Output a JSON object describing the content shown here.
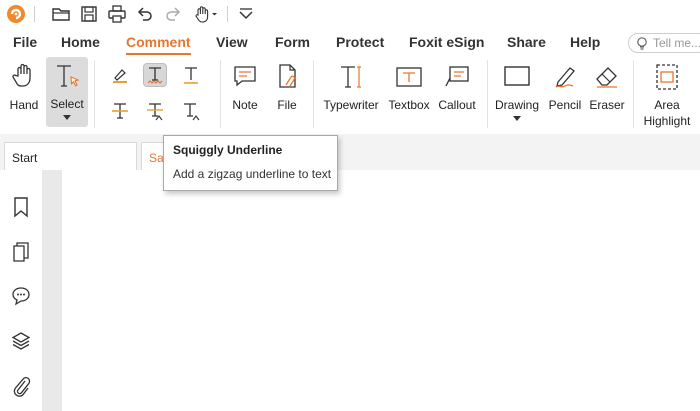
{
  "quick_access": {
    "icons": [
      "foxit-logo-icon",
      "open-folder-icon",
      "save-icon",
      "print-icon",
      "undo-icon",
      "redo-icon",
      "hand-dropdown-icon",
      "customize-chevron-icon"
    ]
  },
  "menu": {
    "tabs": [
      "File",
      "Home",
      "Comment",
      "View",
      "Form",
      "Protect",
      "Foxit eSign",
      "Share",
      "Help"
    ],
    "active_tab": "Comment",
    "tell_me_placeholder": "Tell me..."
  },
  "ribbon": {
    "hand": "Hand",
    "select": "Select",
    "note": "Note",
    "file": "File",
    "typewriter": "Typewriter",
    "textbox": "Textbox",
    "callout": "Callout",
    "drawing": "Drawing",
    "pencil": "Pencil",
    "eraser": "Eraser",
    "area_highlight_line1": "Area",
    "area_highlight_line2": "Highlight"
  },
  "doc_tabs": {
    "start": "Start",
    "sample_partial": "Sar"
  },
  "tooltip": {
    "title": "Squiggly Underline",
    "description": "Add a zigzag underline to text"
  },
  "left_panel_icons": [
    "bookmark-icon",
    "pages-icon",
    "comments-icon",
    "layers-icon",
    "attachment-icon"
  ],
  "colors": {
    "accent": "#e8772e",
    "tooltip_border": "#a9a9a9"
  }
}
